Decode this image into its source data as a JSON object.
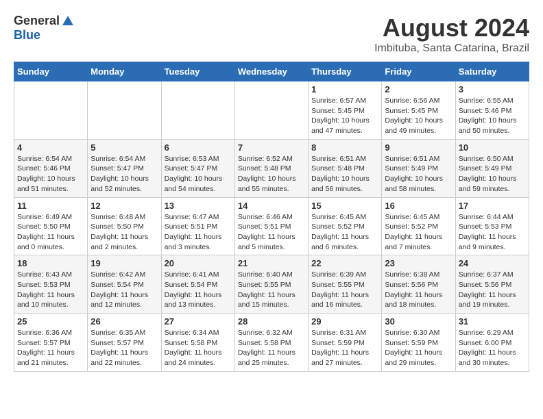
{
  "header": {
    "logo_general": "General",
    "logo_blue": "Blue",
    "title": "August 2024",
    "subtitle": "Imbituba, Santa Catarina, Brazil"
  },
  "calendar": {
    "headers": [
      "Sunday",
      "Monday",
      "Tuesday",
      "Wednesday",
      "Thursday",
      "Friday",
      "Saturday"
    ],
    "rows": [
      [
        {
          "day": "",
          "info": ""
        },
        {
          "day": "",
          "info": ""
        },
        {
          "day": "",
          "info": ""
        },
        {
          "day": "",
          "info": ""
        },
        {
          "day": "1",
          "info": "Sunrise: 6:57 AM\nSunset: 5:45 PM\nDaylight: 10 hours and 47 minutes."
        },
        {
          "day": "2",
          "info": "Sunrise: 6:56 AM\nSunset: 5:45 PM\nDaylight: 10 hours and 49 minutes."
        },
        {
          "day": "3",
          "info": "Sunrise: 6:55 AM\nSunset: 5:46 PM\nDaylight: 10 hours and 50 minutes."
        }
      ],
      [
        {
          "day": "4",
          "info": "Sunrise: 6:54 AM\nSunset: 5:46 PM\nDaylight: 10 hours and 51 minutes."
        },
        {
          "day": "5",
          "info": "Sunrise: 6:54 AM\nSunset: 5:47 PM\nDaylight: 10 hours and 52 minutes."
        },
        {
          "day": "6",
          "info": "Sunrise: 6:53 AM\nSunset: 5:47 PM\nDaylight: 10 hours and 54 minutes."
        },
        {
          "day": "7",
          "info": "Sunrise: 6:52 AM\nSunset: 5:48 PM\nDaylight: 10 hours and 55 minutes."
        },
        {
          "day": "8",
          "info": "Sunrise: 6:51 AM\nSunset: 5:48 PM\nDaylight: 10 hours and 56 minutes."
        },
        {
          "day": "9",
          "info": "Sunrise: 6:51 AM\nSunset: 5:49 PM\nDaylight: 10 hours and 58 minutes."
        },
        {
          "day": "10",
          "info": "Sunrise: 6:50 AM\nSunset: 5:49 PM\nDaylight: 10 hours and 59 minutes."
        }
      ],
      [
        {
          "day": "11",
          "info": "Sunrise: 6:49 AM\nSunset: 5:50 PM\nDaylight: 11 hours and 0 minutes."
        },
        {
          "day": "12",
          "info": "Sunrise: 6:48 AM\nSunset: 5:50 PM\nDaylight: 11 hours and 2 minutes."
        },
        {
          "day": "13",
          "info": "Sunrise: 6:47 AM\nSunset: 5:51 PM\nDaylight: 11 hours and 3 minutes."
        },
        {
          "day": "14",
          "info": "Sunrise: 6:46 AM\nSunset: 5:51 PM\nDaylight: 11 hours and 5 minutes."
        },
        {
          "day": "15",
          "info": "Sunrise: 6:45 AM\nSunset: 5:52 PM\nDaylight: 11 hours and 6 minutes."
        },
        {
          "day": "16",
          "info": "Sunrise: 6:45 AM\nSunset: 5:52 PM\nDaylight: 11 hours and 7 minutes."
        },
        {
          "day": "17",
          "info": "Sunrise: 6:44 AM\nSunset: 5:53 PM\nDaylight: 11 hours and 9 minutes."
        }
      ],
      [
        {
          "day": "18",
          "info": "Sunrise: 6:43 AM\nSunset: 5:53 PM\nDaylight: 11 hours and 10 minutes."
        },
        {
          "day": "19",
          "info": "Sunrise: 6:42 AM\nSunset: 5:54 PM\nDaylight: 11 hours and 12 minutes."
        },
        {
          "day": "20",
          "info": "Sunrise: 6:41 AM\nSunset: 5:54 PM\nDaylight: 11 hours and 13 minutes."
        },
        {
          "day": "21",
          "info": "Sunrise: 6:40 AM\nSunset: 5:55 PM\nDaylight: 11 hours and 15 minutes."
        },
        {
          "day": "22",
          "info": "Sunrise: 6:39 AM\nSunset: 5:55 PM\nDaylight: 11 hours and 16 minutes."
        },
        {
          "day": "23",
          "info": "Sunrise: 6:38 AM\nSunset: 5:56 PM\nDaylight: 11 hours and 18 minutes."
        },
        {
          "day": "24",
          "info": "Sunrise: 6:37 AM\nSunset: 5:56 PM\nDaylight: 11 hours and 19 minutes."
        }
      ],
      [
        {
          "day": "25",
          "info": "Sunrise: 6:36 AM\nSunset: 5:57 PM\nDaylight: 11 hours and 21 minutes."
        },
        {
          "day": "26",
          "info": "Sunrise: 6:35 AM\nSunset: 5:57 PM\nDaylight: 11 hours and 22 minutes."
        },
        {
          "day": "27",
          "info": "Sunrise: 6:34 AM\nSunset: 5:58 PM\nDaylight: 11 hours and 24 minutes."
        },
        {
          "day": "28",
          "info": "Sunrise: 6:32 AM\nSunset: 5:58 PM\nDaylight: 11 hours and 25 minutes."
        },
        {
          "day": "29",
          "info": "Sunrise: 6:31 AM\nSunset: 5:59 PM\nDaylight: 11 hours and 27 minutes."
        },
        {
          "day": "30",
          "info": "Sunrise: 6:30 AM\nSunset: 5:59 PM\nDaylight: 11 hours and 29 minutes."
        },
        {
          "day": "31",
          "info": "Sunrise: 6:29 AM\nSunset: 6:00 PM\nDaylight: 11 hours and 30 minutes."
        }
      ]
    ]
  }
}
